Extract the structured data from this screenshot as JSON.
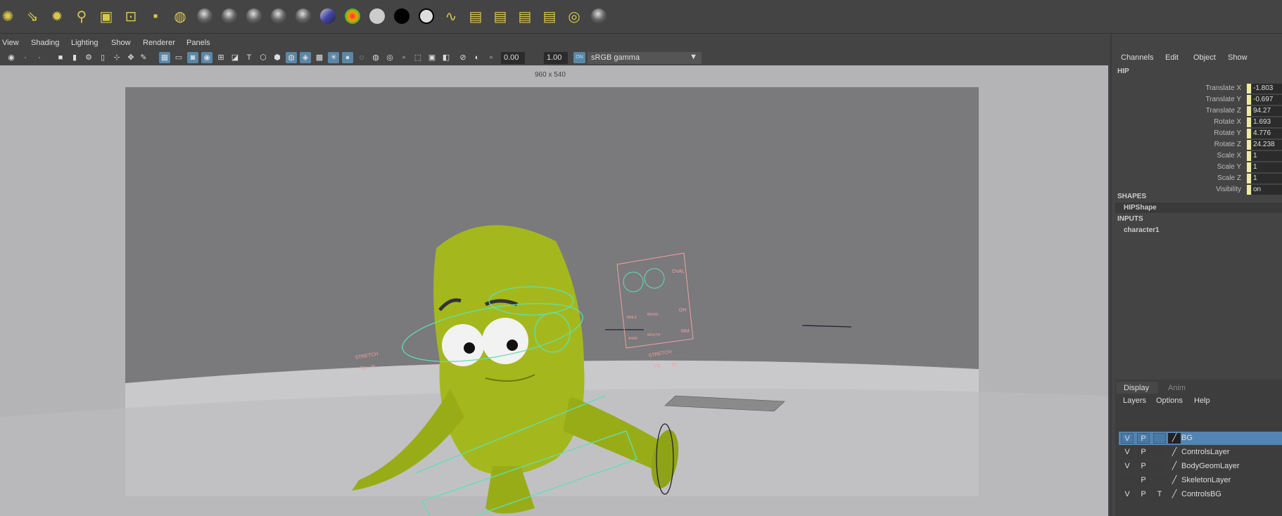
{
  "shelf": {
    "icons": [
      "directional-light",
      "area-light-arrows",
      "point-light",
      "spot-light",
      "area-light",
      "volume-light",
      "ambient-camera",
      "light-editor",
      "sphere-lambert",
      "sphere-blinn",
      "sphere-phong",
      "sphere-phongE",
      "sphere-anisotropic",
      "sphere-ramp",
      "heatmap-sphere",
      "white-sphere",
      "black-sphere",
      "outlined-sphere",
      "hypershade-graph",
      "render-layers",
      "render-layer-delete",
      "render-layer-override",
      "render-setup",
      "render-target",
      "grey-sphere"
    ]
  },
  "menubar": {
    "items": [
      "View",
      "Shading",
      "Lighting",
      "Show",
      "Renderer",
      "Panels"
    ]
  },
  "iconbar": {
    "exposure": "0.00",
    "gamma": "1.00",
    "color_space_toggle": "ON",
    "color_space": "sRGB gamma"
  },
  "viewport": {
    "resolution": "960 x 540",
    "labels": {
      "stretch_left": "STRETCH",
      "fk_left": "FK",
      "ik_left": "IK",
      "stretch_right": "STRETCH",
      "fk_right": "FK",
      "ik_right": "IK",
      "oval": "OVAL",
      "oh": "OH",
      "mm": "MM",
      "smile": "SMILE",
      "brow": "BROW",
      "mouth": "MOUTH",
      "anim": "ANIM"
    }
  },
  "channel_box": {
    "menu": [
      "Channels",
      "Edit",
      "Object",
      "Show"
    ],
    "node": "HIP",
    "channels": [
      {
        "label": "Translate X",
        "value": "-1.803"
      },
      {
        "label": "Translate Y",
        "value": "-0.697"
      },
      {
        "label": "Translate Z",
        "value": "94.27"
      },
      {
        "label": "Rotate X",
        "value": "1.693"
      },
      {
        "label": "Rotate Y",
        "value": "4.776"
      },
      {
        "label": "Rotate Z",
        "value": "24.238"
      },
      {
        "label": "Scale X",
        "value": "1"
      },
      {
        "label": "Scale Y",
        "value": "1"
      },
      {
        "label": "Scale Z",
        "value": "1"
      },
      {
        "label": "Visibility",
        "value": "on"
      }
    ],
    "shapes_header": "SHAPES",
    "shape": "HIPShape",
    "inputs_header": "INPUTS",
    "input": "character1"
  },
  "layers": {
    "tabs": [
      "Display",
      "Anim"
    ],
    "menu": [
      "Layers",
      "Options",
      "Help"
    ],
    "rows": [
      {
        "v": "V",
        "p": "P",
        "t": "",
        "name": "BG",
        "selected": true
      },
      {
        "v": "V",
        "p": "P",
        "t": "",
        "name": "ControlsLayer"
      },
      {
        "v": "V",
        "p": "P",
        "t": "",
        "name": "BodyGeomLayer"
      },
      {
        "v": "",
        "p": "P",
        "t": "",
        "name": "SkeletonLayer"
      },
      {
        "v": "V",
        "p": "P",
        "t": "T",
        "name": "ControlsBG"
      }
    ]
  },
  "colors": {
    "accent": "#5285b3",
    "body": "#a8b820",
    "control": "#5fe0b0",
    "panel_ctrl": "#f0a0a0"
  }
}
